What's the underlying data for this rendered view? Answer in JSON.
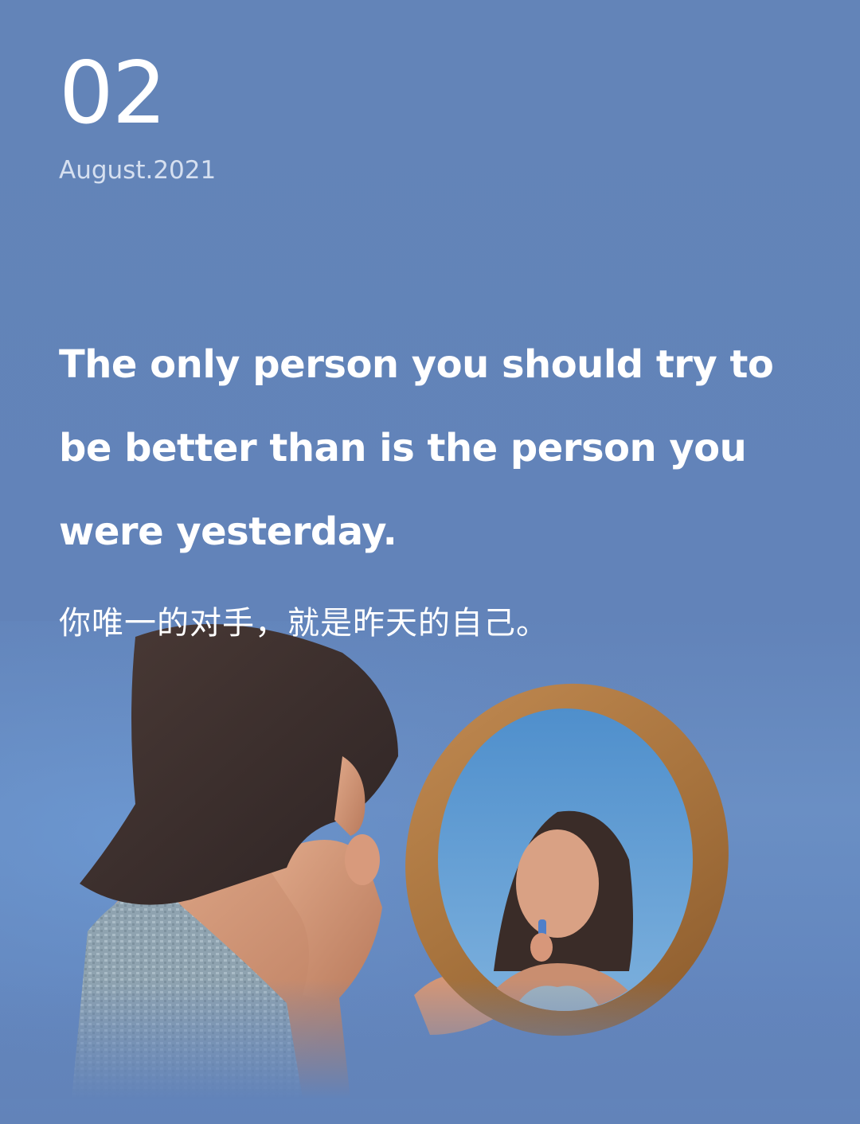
{
  "header": {
    "day": "02",
    "date": "August.2021"
  },
  "quote": {
    "english": "The only person you should try to be better than is the person you were yesterday.",
    "chinese": "你唯一的对手，就是昨天的自己。"
  },
  "photo": {
    "subject": "woman-looking-in-round-wooden-mirror"
  },
  "colors": {
    "background": "#6283b9",
    "text": "#ffffff",
    "date_text": "#d6e0f0",
    "mirror_frame": "#a8743e"
  }
}
